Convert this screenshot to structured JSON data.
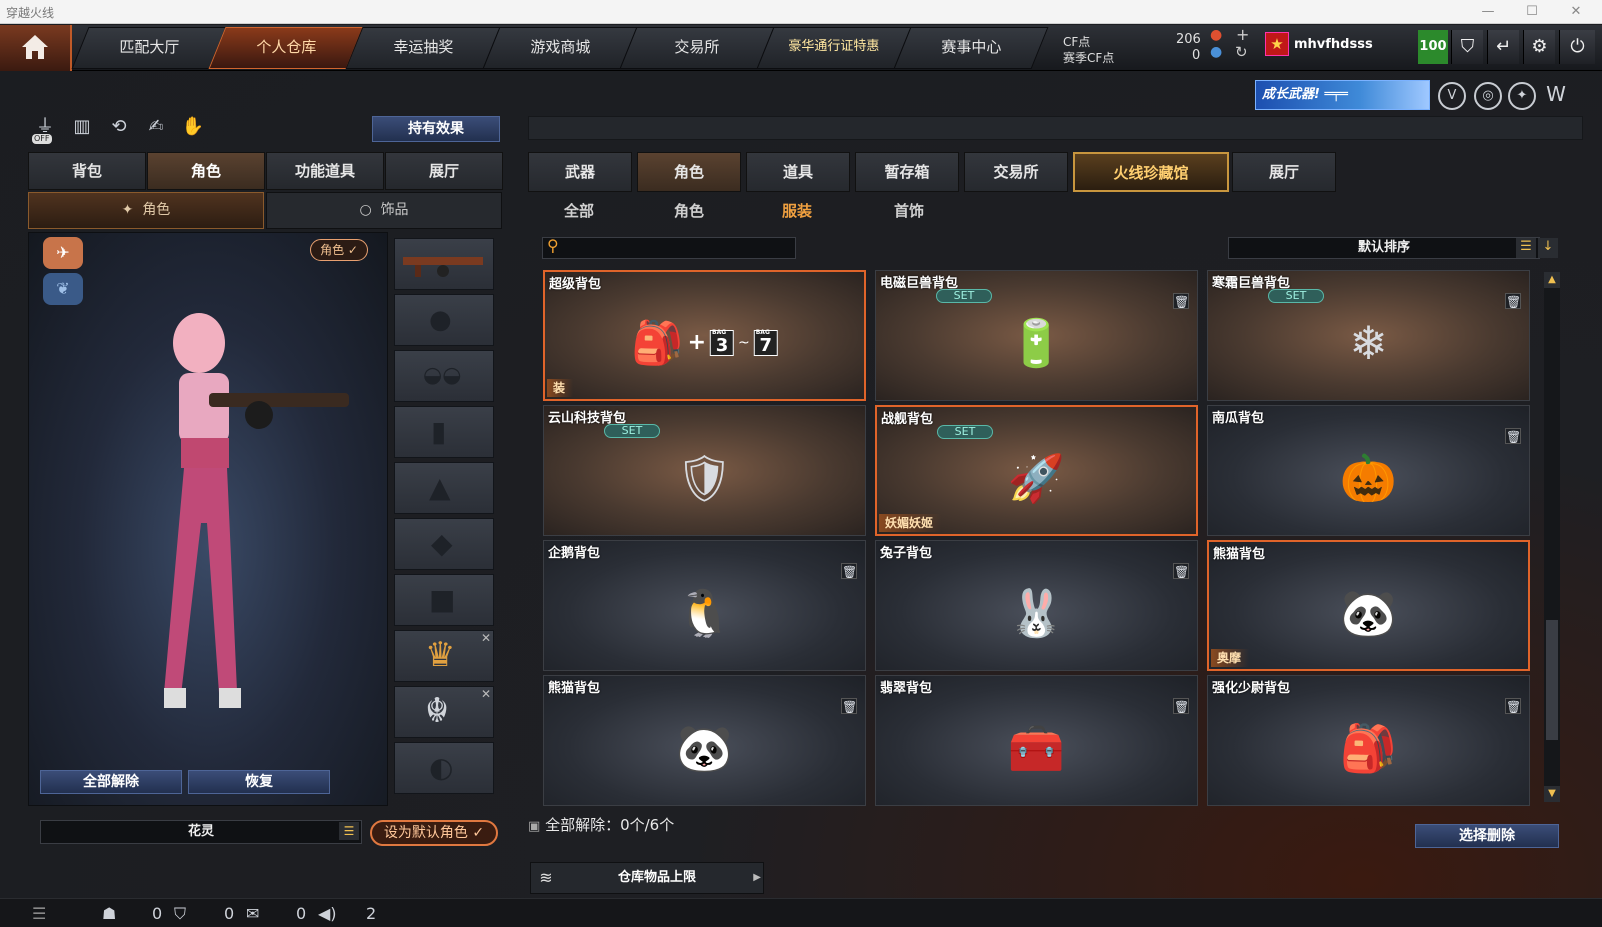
{
  "window": {
    "title": "穿越火线"
  },
  "nav": {
    "tabs": [
      {
        "label": "匹配大厅"
      },
      {
        "label": "个人仓库"
      },
      {
        "label": "幸运抽奖"
      },
      {
        "label": "游戏商城"
      },
      {
        "label": "交易所"
      },
      {
        "label": "豪华通行证特惠"
      },
      {
        "label": "赛事中心"
      }
    ]
  },
  "currency": {
    "cf_label": "CF点",
    "cf_value": "206",
    "season_label": "赛季CF点",
    "season_value": "0"
  },
  "user": {
    "name": "mhvfhdsss",
    "level": "100"
  },
  "banner": {
    "text": "成长武器!"
  },
  "left": {
    "effects_button": "持有效果",
    "tabs": [
      "背包",
      "角色",
      "功能道具",
      "展厅"
    ],
    "subtabs": [
      "角色",
      "饰品"
    ],
    "role_badge": "角色 ✓",
    "clear_all": "全部解除",
    "restore": "恢复",
    "character_name": "花灵",
    "set_default": "设为默认角色 ✓"
  },
  "right": {
    "tabs": [
      "武器",
      "角色",
      "道具",
      "暂存箱",
      "交易所",
      "火线珍藏馆",
      "展厅"
    ],
    "subtabs": [
      "全部",
      "角色",
      "服装",
      "首饰"
    ],
    "sort_label": "默认排序",
    "items": [
      {
        "name": "超级背包",
        "set": "",
        "tag": "装",
        "lock": "",
        "icon": "🎒",
        "bag_from": "3",
        "bag_to": "7",
        "bag_label": "BAG"
      },
      {
        "name": "电磁巨兽背包",
        "set": "SET",
        "tag": "",
        "lock": "🗑",
        "icon": "🔋"
      },
      {
        "name": "寒霜巨兽背包",
        "set": "SET",
        "tag": "",
        "lock": "🗑",
        "icon": "❄"
      },
      {
        "name": "云山科技背包",
        "set": "SET",
        "tag": "",
        "lock": "",
        "icon": "🛡"
      },
      {
        "name": "战舰背包",
        "set": "SET",
        "tag": "妖媚妖姬",
        "lock": "",
        "icon": "🚀"
      },
      {
        "name": "南瓜背包",
        "set": "",
        "tag": "",
        "lock": "🗑",
        "icon": "🎃"
      },
      {
        "name": "企鹅背包",
        "set": "",
        "tag": "",
        "lock": "🗑",
        "icon": "🐧"
      },
      {
        "name": "兔子背包",
        "set": "",
        "tag": "",
        "lock": "🗑",
        "icon": "🐰"
      },
      {
        "name": "熊猫背包",
        "set": "",
        "tag": "奥摩",
        "lock": "",
        "icon": "🐼"
      },
      {
        "name": "熊猫背包",
        "set": "",
        "tag": "",
        "lock": "🗑",
        "icon": "🐼"
      },
      {
        "name": "翡翠背包",
        "set": "",
        "tag": "",
        "lock": "🗑",
        "icon": "🧰"
      },
      {
        "name": "强化少尉背包",
        "set": "",
        "tag": "",
        "lock": "🗑",
        "icon": "🎒"
      }
    ],
    "clear_status": "全部解除：0个/6个",
    "select_delete": "选择删除",
    "capacity_label": "仓库物品上限"
  },
  "status": {
    "friends": "0",
    "guild": "0",
    "chat": "0",
    "volume": "2"
  }
}
